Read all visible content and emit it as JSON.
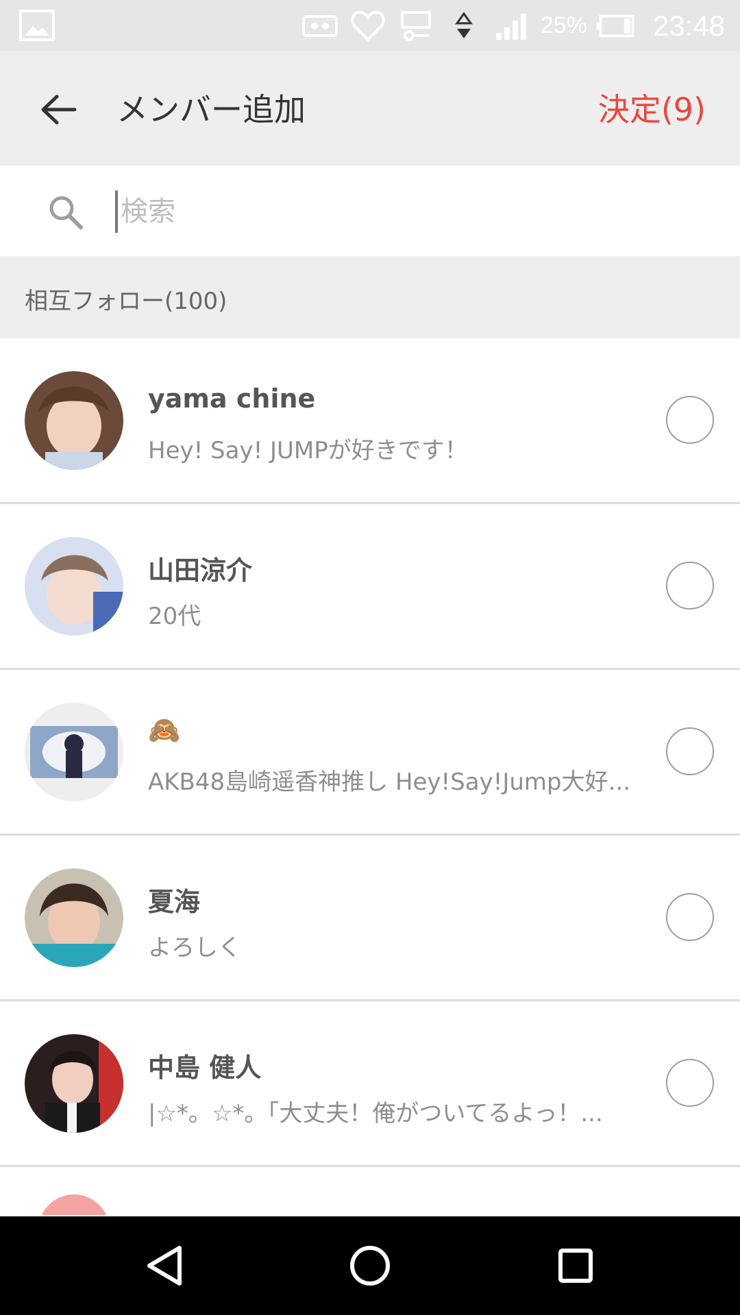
{
  "status_bar": {
    "battery_percent": "25%",
    "time": "23:48",
    "icons": [
      "image-icon",
      "hotspot-icon",
      "heart-icon",
      "nfc-key-icon",
      "data-arrows-icon",
      "signal-icon",
      "battery-icon"
    ]
  },
  "app_bar": {
    "back_icon": "arrow-left-icon",
    "title": "メンバー追加",
    "confirm_label": "決定(9)",
    "accent_color": "#e8473f"
  },
  "search": {
    "placeholder": "検索",
    "value": ""
  },
  "section": {
    "label": "相互フォロー(100)"
  },
  "members": [
    {
      "name": "yama chine",
      "subtitle": "Hey! Say! JUMPが好きです！",
      "selected": false
    },
    {
      "name": "山田涼介",
      "subtitle": "20代",
      "selected": false
    },
    {
      "name": "🙈",
      "subtitle": "AKB48島崎遥香神推し  Hey!Say!Jump大好...",
      "selected": false
    },
    {
      "name": "夏海",
      "subtitle": "よろしく",
      "selected": false
    },
    {
      "name": "中島 健人",
      "subtitle": "|☆*。☆*。「大丈夫！俺がついてるよっ！...",
      "selected": false
    }
  ],
  "nav_bar": {
    "icons": [
      "back-triangle-icon",
      "home-circle-icon",
      "recents-square-icon"
    ]
  }
}
